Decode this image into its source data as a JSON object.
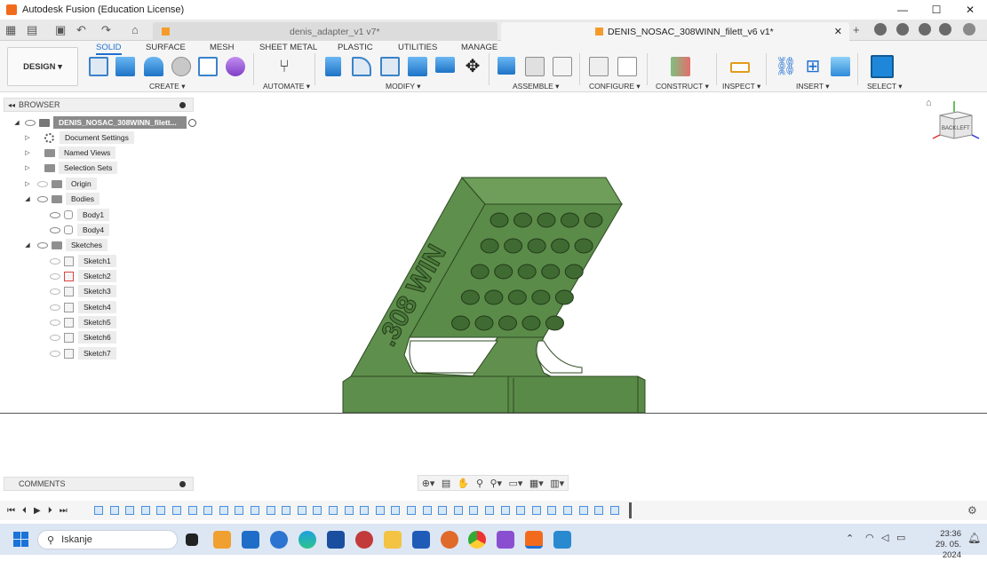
{
  "window": {
    "title": "Autodesk Fusion (Education License)",
    "controls": [
      "—",
      "☐",
      "✕"
    ]
  },
  "tabs": [
    {
      "label": "denis_adapter_v1 v7*",
      "active": false
    },
    {
      "label": "DENIS_NOSAC_308WINN_filett_v6 v1*",
      "active": true
    }
  ],
  "ribbon": {
    "workspace": "DESIGN ▾",
    "tabs": [
      "SOLID",
      "SURFACE",
      "MESH",
      "SHEET METAL",
      "PLASTIC",
      "UTILITIES",
      "MANAGE"
    ],
    "groups": {
      "create": "CREATE ▾",
      "automate": "AUTOMATE ▾",
      "modify": "MODIFY ▾",
      "assemble": "ASSEMBLE ▾",
      "configure": "CONFIGURE ▾",
      "construct": "CONSTRUCT ▾",
      "inspect": "INSPECT ▾",
      "insert": "INSERT ▾",
      "select": "SELECT ▾"
    }
  },
  "browser": {
    "header": "BROWSER",
    "root": "DENIS_NOSAC_308WINN_filett...",
    "items": {
      "document_settings": "Document Settings",
      "named_views": "Named Views",
      "selection_sets": "Selection Sets",
      "origin": "Origin",
      "bodies": "Bodies",
      "body1": "Body1",
      "body4": "Body4",
      "sketches": "Sketches",
      "sketch1": "Sketch1",
      "sketch2": "Sketch2",
      "sketch3": "Sketch3",
      "sketch4": "Sketch4",
      "sketch5": "Sketch5",
      "sketch6": "Sketch6",
      "sketch7": "Sketch7"
    }
  },
  "model": {
    "engraving": ".308 WIN",
    "color": "#5a8a48"
  },
  "viewcube": {
    "back": "BACK",
    "left": "LEFT"
  },
  "comments": {
    "header": "COMMENTS"
  },
  "taskbar": {
    "search_placeholder": "Iskanje",
    "time": "23:36",
    "date": "29. 05. 2024"
  }
}
